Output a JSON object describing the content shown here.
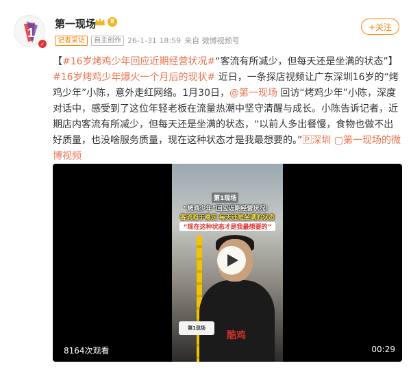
{
  "author": {
    "name": "第一现场",
    "level_badge": "Ⅱ",
    "avatar_mark": "1",
    "tags": [
      "记者采访",
      "自主创作"
    ],
    "timestamp": "26-1-31 18:59",
    "source": "来自 微博视频号"
  },
  "follow": {
    "label": "+关注"
  },
  "post": {
    "segments": [
      {
        "text": "【",
        "hl": false
      },
      {
        "text": "#16岁烤鸡少年回应近期经营状况#",
        "hl": true
      },
      {
        "text": "“客流有所减少，但每天还是坐满的状态”】",
        "hl": false
      },
      {
        "text": "#16岁烤鸡少年爆火一个月后的现状#",
        "hl": true
      },
      {
        "text": " 近日，一条探店视频让广东深圳16岁的“烤鸡少年”小陈，意外走红网络。1月30日，",
        "hl": false
      },
      {
        "text": "@第一现场",
        "hl": true
      },
      {
        "text": " 回访“烤鸡少年”小陈，深度对话中，感受到了这位年轻老板在流量热潮中坚守清醒与成长。小陈告诉记者，近期店内客流有所减少，但每天还是坐满的状态，“以前人多出餐慢，食物也做不出好质量，也没啥服务质量，现在这种状态才是我最想要的。”",
        "hl": false
      },
      {
        "text": "🄿深圳",
        "hl": true
      },
      {
        "text": " ",
        "hl": false
      },
      {
        "text": "▢第一现场的微博视频",
        "hl": true
      }
    ]
  },
  "video": {
    "logo": "第1现场",
    "caption_line1": "“烤鸡少年”回应近期经营状况：",
    "caption_line2": "客流趋于稳定 每天还是坐满的状态",
    "caption_line3": "“现在这种状态才是我最想要的”",
    "shirt_text": "酷鸡",
    "mic_label": "第1现场",
    "views": "8164次观看",
    "duration": "00:29"
  },
  "colors": {
    "accent": "#ff8200",
    "link": "#eb7350"
  }
}
